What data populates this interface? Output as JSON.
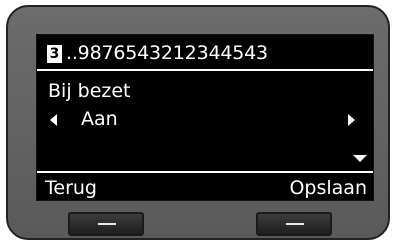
{
  "header": {
    "line_badge": "3",
    "number": "..9876543212344543"
  },
  "setting": {
    "label": "Bij bezet",
    "value": "Aan"
  },
  "softkeys": {
    "left_label": "Terug",
    "right_label": "Opslaan"
  },
  "icons": {
    "prev": "chevron-left-icon",
    "next": "chevron-right-icon",
    "more": "chevron-down-icon"
  },
  "colors": {
    "screen_bg": "#000000",
    "text": "#ffffff",
    "device_body": "#636363"
  }
}
